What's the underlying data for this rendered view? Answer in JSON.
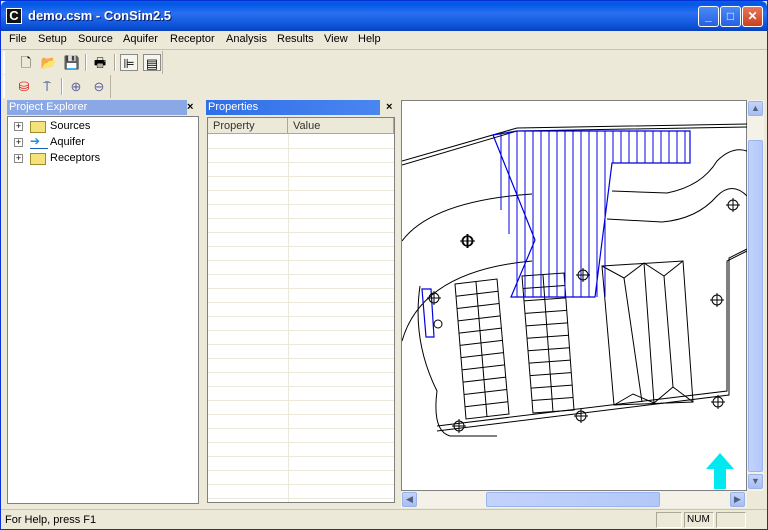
{
  "window": {
    "title": "demo.csm - ConSim2.5",
    "app_icon": "C",
    "controls": {
      "minimize": "_",
      "maximize": "□",
      "close": "✕"
    }
  },
  "menu": [
    "File",
    "Setup",
    "Source",
    "Aquifer",
    "Receptor",
    "Analysis",
    "Results",
    "View",
    "Help"
  ],
  "toolbar1": [
    {
      "name": "new-file-icon",
      "glyph": "🗋"
    },
    {
      "name": "open-folder-icon",
      "glyph": "📂"
    },
    {
      "name": "save-icon",
      "glyph": "💾"
    },
    {
      "name": "print-icon",
      "glyph": "🖶"
    },
    {
      "name": "tree-view-icon",
      "glyph": "⊫"
    },
    {
      "name": "properties-icon",
      "glyph": "▤"
    }
  ],
  "toolbar2": [
    {
      "name": "add-source-icon",
      "glyph": "⛁"
    },
    {
      "name": "add-receptor-icon",
      "glyph": "⍑"
    },
    {
      "name": "zoom-in-icon",
      "glyph": "⊕"
    },
    {
      "name": "zoom-out-icon",
      "glyph": "⊖"
    }
  ],
  "project_explorer": {
    "title": "Project Explorer",
    "close": "×",
    "items": [
      {
        "label": "Sources",
        "icon": "folder-icon"
      },
      {
        "label": "Aquifer",
        "icon": "aquifer-arrow-icon"
      },
      {
        "label": "Receptors",
        "icon": "folder-icon"
      }
    ]
  },
  "properties": {
    "title": "Properties",
    "close": "×",
    "columns": [
      "Property",
      "Value"
    ],
    "rows": []
  },
  "colors": {
    "accent_blue": "#0000e0",
    "north_arrow": "#00e8f0",
    "active_panel": "#2f6fe8",
    "inactive_panel": "#8aa8e6"
  },
  "statusbar": {
    "help": "For Help, press F1",
    "indicators": [
      "",
      "NUM",
      ""
    ]
  }
}
